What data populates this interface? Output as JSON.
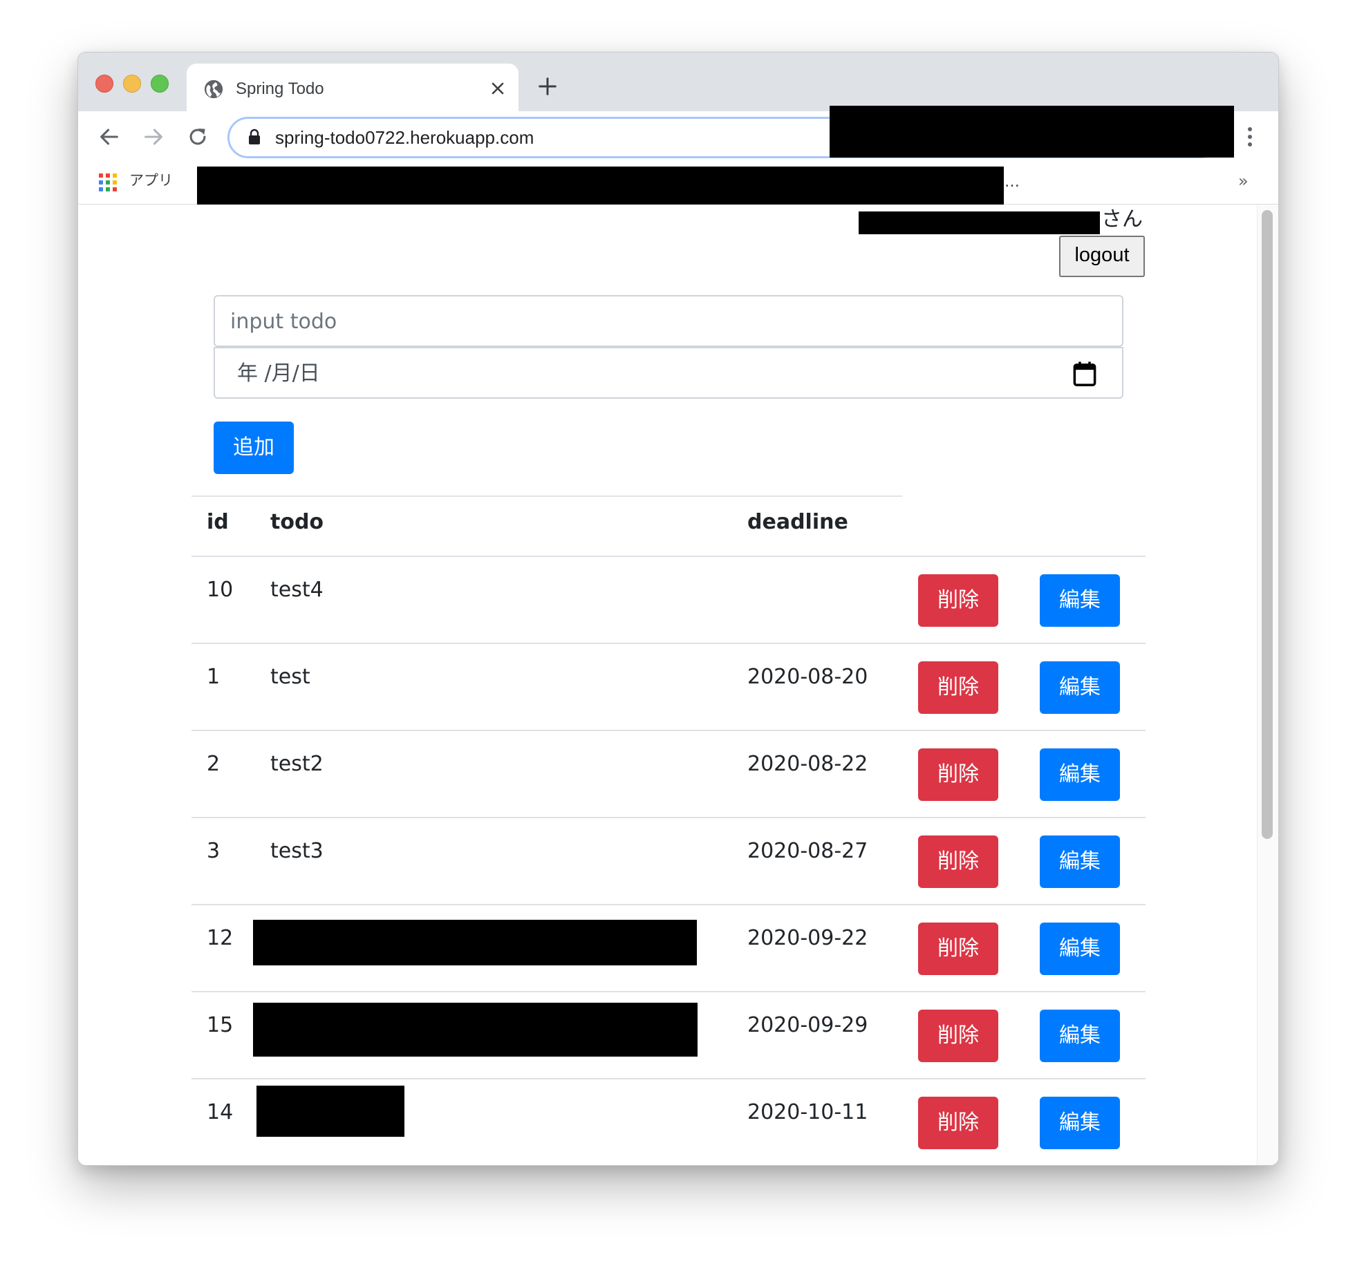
{
  "browser": {
    "tab_title": "Spring Todo",
    "url": "spring-todo0722.herokuapp.com",
    "bookmarks": {
      "apps_label": "アプリ",
      "overflow_text": "…",
      "more_chevron": "»"
    }
  },
  "header": {
    "user_suffix": "さん",
    "logout_label": "logout"
  },
  "form": {
    "todo_placeholder": "input todo",
    "date_placeholder": "年 /月/日",
    "add_label": "追加"
  },
  "table": {
    "headers": {
      "id": "id",
      "todo": "todo",
      "deadline": "deadline"
    },
    "delete_label": "削除",
    "edit_label": "編集",
    "rows": [
      {
        "id": "10",
        "todo": "test4",
        "deadline": ""
      },
      {
        "id": "1",
        "todo": "test",
        "deadline": "2020-08-20"
      },
      {
        "id": "2",
        "todo": "test2",
        "deadline": "2020-08-22"
      },
      {
        "id": "3",
        "todo": "test3",
        "deadline": "2020-08-27"
      },
      {
        "id": "12",
        "todo": "",
        "deadline": "2020-09-22",
        "todo_redacted": true
      },
      {
        "id": "15",
        "todo": "",
        "deadline": "2020-09-29",
        "todo_redacted": true
      },
      {
        "id": "14",
        "todo": "",
        "deadline": "2020-10-11",
        "todo_redacted": true
      }
    ]
  },
  "colors": {
    "primary": "#007bff",
    "danger": "#dc3545",
    "tabstrip": "#dee1e6",
    "omnibox_border": "#a8c7fa"
  }
}
